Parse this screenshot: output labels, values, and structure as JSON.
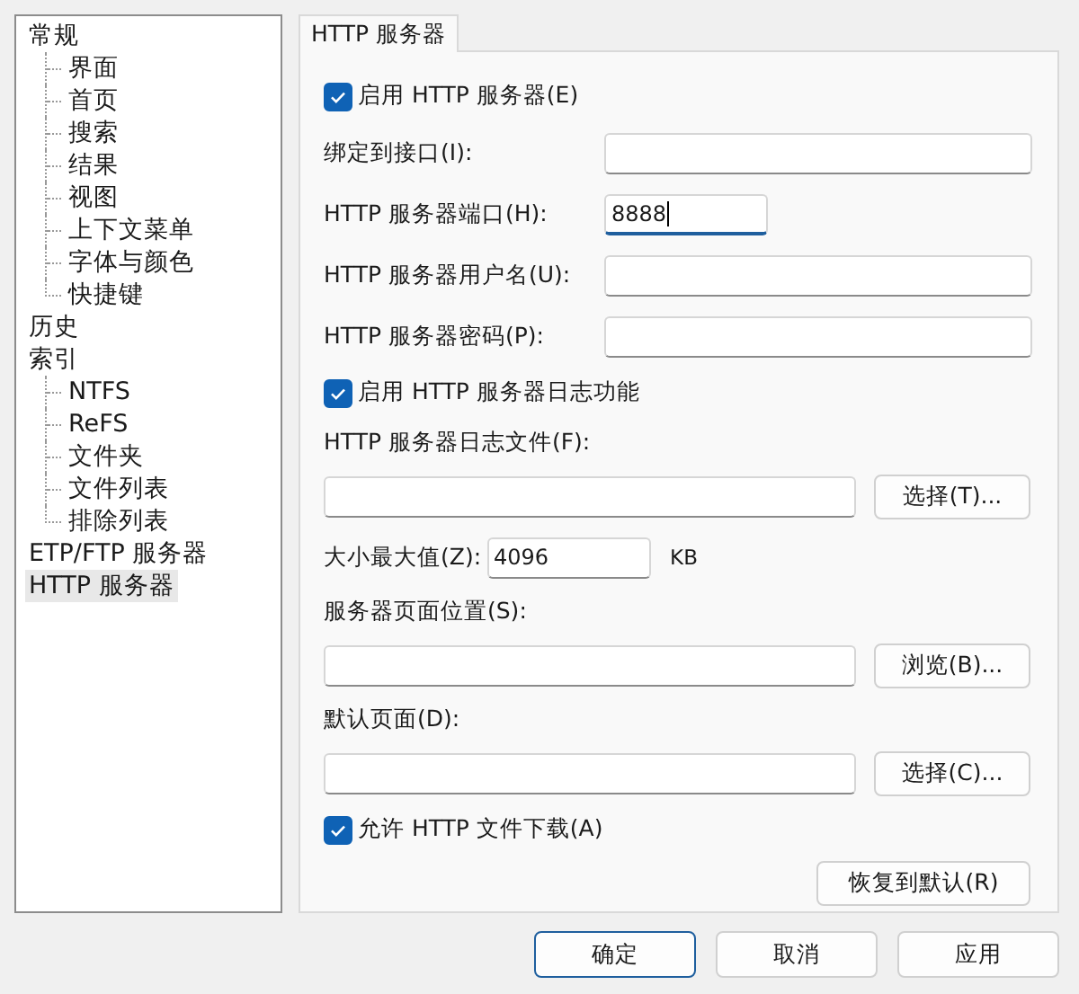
{
  "sidebar": {
    "items": [
      {
        "label": "常规",
        "selected": false,
        "children": [
          {
            "label": "界面",
            "selected": false
          },
          {
            "label": "首页",
            "selected": false
          },
          {
            "label": "搜索",
            "selected": false
          },
          {
            "label": "结果",
            "selected": false
          },
          {
            "label": "视图",
            "selected": false
          },
          {
            "label": "上下文菜单",
            "selected": false
          },
          {
            "label": "字体与颜色",
            "selected": false
          },
          {
            "label": "快捷键",
            "selected": false
          }
        ]
      },
      {
        "label": "历史",
        "selected": false
      },
      {
        "label": "索引",
        "selected": false,
        "children": [
          {
            "label": "NTFS",
            "selected": false
          },
          {
            "label": "ReFS",
            "selected": false
          },
          {
            "label": "文件夹",
            "selected": false
          },
          {
            "label": "文件列表",
            "selected": false
          },
          {
            "label": "排除列表",
            "selected": false
          }
        ]
      },
      {
        "label": "ETP/FTP 服务器",
        "selected": false
      },
      {
        "label": "HTTP 服务器",
        "selected": true
      }
    ]
  },
  "tabs": [
    {
      "label": "HTTP 服务器",
      "selected": true
    }
  ],
  "form": [
    {
      "kind": "checkbox",
      "label": "启用 HTTP 服务器(E)",
      "checked": true
    },
    {
      "kind": "field",
      "label": "绑定到接口(I):",
      "focused": false
    },
    {
      "kind": "short-field",
      "label": "HTTP 服务器端口(H):",
      "value": "8888",
      "focused": true
    },
    {
      "kind": "field",
      "label": "HTTP 服务器用户名(U):",
      "focused": false
    },
    {
      "kind": "field",
      "label": "HTTP 服务器密码(P):",
      "focused": false
    },
    {
      "kind": "checkbox",
      "label": "启用 HTTP 服务器日志功能",
      "checked": true
    },
    {
      "kind": "label",
      "label": "HTTP 服务器日志文件(F):"
    },
    {
      "kind": "file",
      "button": "选择(T)..."
    },
    {
      "kind": "size",
      "label": "大小最大值(Z):",
      "value": "4096",
      "unit": "KB"
    },
    {
      "kind": "label",
      "label": "服务器页面位置(S):"
    },
    {
      "kind": "file",
      "button": "浏览(B)..."
    },
    {
      "kind": "label",
      "label": "默认页面(D):"
    },
    {
      "kind": "file",
      "button": "选择(C)..."
    },
    {
      "kind": "checkbox",
      "label": "允许 HTTP 文件下载(A)",
      "checked": true
    },
    {
      "kind": "button",
      "label": "恢复到默认(R)"
    }
  ],
  "buttons": [
    {
      "label": "确定",
      "default": true
    },
    {
      "label": "取消",
      "default": false
    },
    {
      "label": "应用",
      "default": false
    }
  ]
}
